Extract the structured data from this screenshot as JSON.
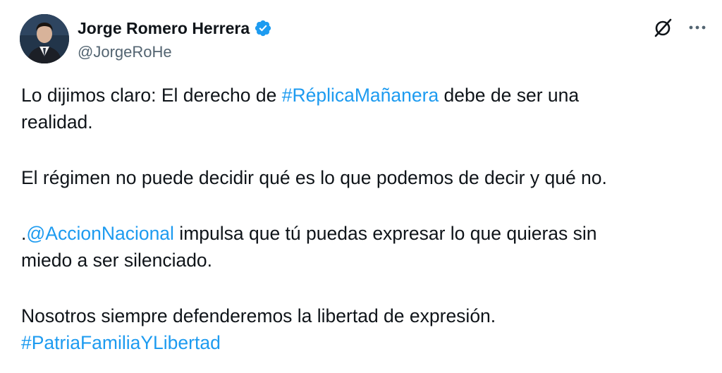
{
  "author": {
    "display_name": "Jorge Romero Herrera",
    "handle": "@JorgeRoHe",
    "verified_icon": "verified-badge-icon",
    "verified_color": "#1d9bf0"
  },
  "actions": {
    "grok_icon": "grok-icon",
    "more_icon": "more-options-icon"
  },
  "tweet": {
    "p1_line1_pre": "Lo dijimos claro: El derecho de ",
    "p1_hashtag": "#RéplicaMañanera",
    "p1_line1_post": " debe de ser una",
    "p1_line2": "realidad.",
    "p2": "El régimen no puede decidir qué es lo que podemos de decir y qué no.",
    "p3_pre": ".",
    "p3_mention": "@AccionNacional",
    "p3_line1_post": " impulsa que tú puedas expresar lo que quieras sin",
    "p3_line2": "miedo a ser silenciado.",
    "p4": "Nosotros siempre defenderemos la libertad de expresión.",
    "p4_hashtag": "#PatriaFamiliaYLibertad"
  },
  "colors": {
    "text": "#0f1419",
    "secondary": "#536471",
    "link": "#1d9bf0"
  }
}
